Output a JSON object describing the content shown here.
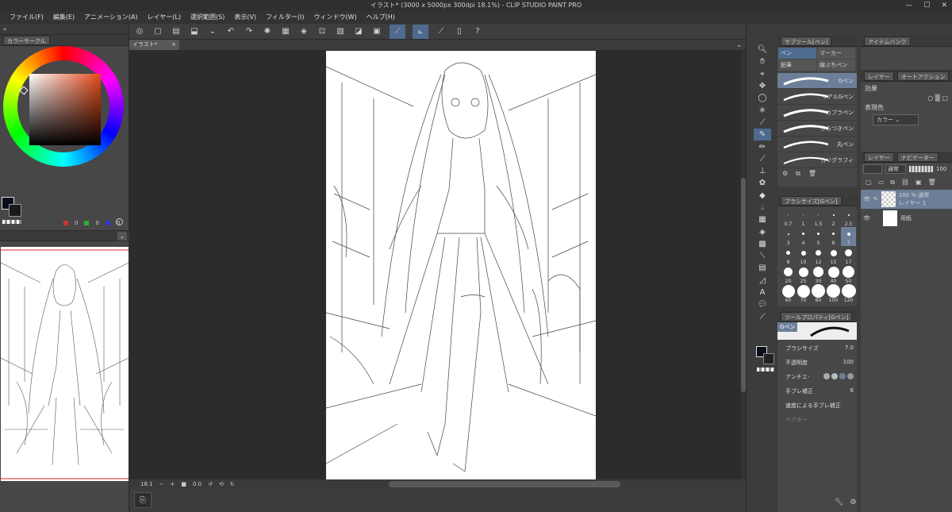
{
  "window": {
    "title": "イラスト* (3000 x 5000px 300dpi 18.1%) - CLIP STUDIO PAINT PRO"
  },
  "menu": [
    "ファイル(F)",
    "編集(E)",
    "アニメーション(A)",
    "レイヤー(L)",
    "選択範囲(S)",
    "表示(V)",
    "フィルター(I)",
    "ウィンドウ(W)",
    "ヘルプ(H)"
  ],
  "left": {
    "color_tab": "カラーサークル",
    "rgb": {
      "r": "0",
      "g": "0",
      "b": "0"
    }
  },
  "document": {
    "tab": "イラスト*"
  },
  "status": {
    "zoom": "18.1",
    "angle": "0.0"
  },
  "subtool": {
    "header": "サブツール[ペン]",
    "groups": [
      "ペン",
      "マーカー",
      "鉛筆",
      "線ぶちペン"
    ],
    "brushes": [
      "Gペン",
      "リアルGペン",
      "カブラペン",
      "さらつきペン",
      "丸ペン",
      "カリグラフィ"
    ]
  },
  "brush_size": {
    "header": "ブラシサイズ[Gペン]",
    "sizes": [
      "0.7",
      "1",
      "1.5",
      "2",
      "2.5",
      "3",
      "4",
      "5",
      "6",
      "7",
      "8",
      "10",
      "12",
      "15",
      "17",
      "20",
      "25",
      "30",
      "40",
      "50",
      "60",
      "70",
      "80",
      "100",
      "120"
    ]
  },
  "tool_property": {
    "header": "ツールプロパティ[Gペン]",
    "tool_name": "Gペン",
    "rows": [
      {
        "label": "ブラシサイズ",
        "value": "7.0"
      },
      {
        "label": "不透明度",
        "value": "100"
      },
      {
        "label": "アンチエイリアス",
        "value": ""
      },
      {
        "label": "手ブレ補正",
        "value": "6"
      },
      {
        "label": "速度による手ブレ補正",
        "value": ""
      },
      {
        "label": "ベクター",
        "value": ""
      }
    ]
  },
  "right": {
    "tabs_top": [
      "アイテムバンク"
    ],
    "tabs_mid": [
      "レイヤー",
      "オートアクション"
    ],
    "effect_label": "効果",
    "expression_label": "表現色",
    "expression_value": "カラー",
    "layer_tabs": [
      "レイヤー",
      "ナビゲーター"
    ],
    "blend_mode": "通常",
    "opacity": "100",
    "layers": [
      {
        "meta": "100 % 通常",
        "name": "レイヤー 1"
      },
      {
        "meta": "",
        "name": "用紙"
      }
    ]
  }
}
